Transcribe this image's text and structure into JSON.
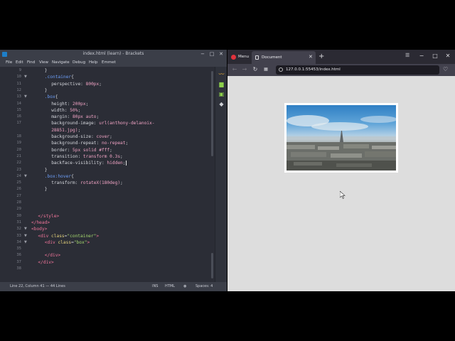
{
  "editor": {
    "title": "index.html (learn) - Brackets",
    "menu": [
      "File",
      "Edit",
      "Find",
      "View",
      "Navigate",
      "Debug",
      "Help",
      "Emmet"
    ],
    "window_controls": [
      "−",
      "□",
      "✕"
    ],
    "lines": [
      {
        "n": "9",
        "fold": "",
        "indent": 2,
        "tokens": [
          {
            "c": "pun",
            "t": "}"
          }
        ]
      },
      {
        "n": "10",
        "fold": "▼",
        "indent": 2,
        "tokens": [
          {
            "c": "sel",
            "t": ".container"
          },
          {
            "c": "pun",
            "t": "{"
          }
        ]
      },
      {
        "n": "11",
        "fold": "",
        "indent": 3,
        "tokens": [
          {
            "c": "prop",
            "t": "perspective: "
          },
          {
            "c": "val",
            "t": "800px"
          },
          {
            "c": "pun",
            "t": ";"
          }
        ]
      },
      {
        "n": "12",
        "fold": "",
        "indent": 2,
        "tokens": [
          {
            "c": "pun",
            "t": "}"
          }
        ]
      },
      {
        "n": "13",
        "fold": "▼",
        "indent": 2,
        "tokens": [
          {
            "c": "sel",
            "t": ".box"
          },
          {
            "c": "pun",
            "t": "{"
          }
        ]
      },
      {
        "n": "14",
        "fold": "",
        "indent": 3,
        "tokens": [
          {
            "c": "prop",
            "t": "height: "
          },
          {
            "c": "val",
            "t": "200px"
          },
          {
            "c": "pun",
            "t": ";"
          }
        ]
      },
      {
        "n": "15",
        "fold": "",
        "indent": 3,
        "tokens": [
          {
            "c": "prop",
            "t": "width: "
          },
          {
            "c": "val",
            "t": "50%"
          },
          {
            "c": "pun",
            "t": ";"
          }
        ]
      },
      {
        "n": "16",
        "fold": "",
        "indent": 3,
        "tokens": [
          {
            "c": "prop",
            "t": "margin: "
          },
          {
            "c": "val",
            "t": "80px auto"
          },
          {
            "c": "pun",
            "t": ";"
          }
        ]
      },
      {
        "n": "17",
        "fold": "",
        "indent": 3,
        "tokens": [
          {
            "c": "prop",
            "t": "background-image: "
          },
          {
            "c": "val",
            "t": "url(anthony-delanoix-"
          }
        ]
      },
      {
        "n": "",
        "fold": "",
        "indent": 3,
        "tokens": [
          {
            "c": "val",
            "t": "28851.jpg)"
          },
          {
            "c": "pun",
            "t": ";"
          }
        ]
      },
      {
        "n": "18",
        "fold": "",
        "indent": 3,
        "tokens": [
          {
            "c": "prop",
            "t": "background-size: "
          },
          {
            "c": "val",
            "t": "cover"
          },
          {
            "c": "pun",
            "t": ";"
          }
        ]
      },
      {
        "n": "19",
        "fold": "",
        "indent": 3,
        "tokens": [
          {
            "c": "prop",
            "t": "background-repeat: "
          },
          {
            "c": "val",
            "t": "no-repeat"
          },
          {
            "c": "pun",
            "t": ";"
          }
        ]
      },
      {
        "n": "20",
        "fold": "",
        "indent": 3,
        "tokens": [
          {
            "c": "prop",
            "t": "border: "
          },
          {
            "c": "val",
            "t": "5px solid #fff"
          },
          {
            "c": "pun",
            "t": ";"
          }
        ]
      },
      {
        "n": "21",
        "fold": "",
        "indent": 3,
        "tokens": [
          {
            "c": "prop",
            "t": "transition: "
          },
          {
            "c": "val",
            "t": "transform 0.3s"
          },
          {
            "c": "pun",
            "t": ";"
          }
        ]
      },
      {
        "n": "22",
        "fold": "",
        "indent": 3,
        "cursor": true,
        "tokens": [
          {
            "c": "prop",
            "t": "backface-visibility: "
          },
          {
            "c": "val",
            "t": "hidden"
          },
          {
            "c": "pun",
            "t": ";"
          }
        ]
      },
      {
        "n": "23",
        "fold": "",
        "indent": 2,
        "tokens": [
          {
            "c": "pun",
            "t": "}"
          }
        ]
      },
      {
        "n": "24",
        "fold": "▼",
        "indent": 2,
        "tokens": [
          {
            "c": "sel",
            "t": ".box:hover"
          },
          {
            "c": "pun",
            "t": "{"
          }
        ]
      },
      {
        "n": "25",
        "fold": "",
        "indent": 3,
        "tokens": [
          {
            "c": "prop",
            "t": "transform: "
          },
          {
            "c": "val",
            "t": "rotateX(180deg)"
          },
          {
            "c": "pun",
            "t": ";"
          }
        ]
      },
      {
        "n": "26",
        "fold": "",
        "indent": 2,
        "tokens": [
          {
            "c": "pun",
            "t": "}"
          }
        ]
      },
      {
        "n": "27",
        "fold": "",
        "indent": 0,
        "tokens": []
      },
      {
        "n": "28",
        "fold": "",
        "indent": 0,
        "tokens": []
      },
      {
        "n": "29",
        "fold": "",
        "indent": 0,
        "tokens": []
      },
      {
        "n": "30",
        "fold": "",
        "indent": 1,
        "tokens": [
          {
            "c": "tag",
            "t": "</style>"
          }
        ]
      },
      {
        "n": "31",
        "fold": "",
        "indent": 0,
        "tokens": [
          {
            "c": "tag",
            "t": "</head>"
          }
        ]
      },
      {
        "n": "32",
        "fold": "▼",
        "indent": 0,
        "tokens": [
          {
            "c": "tag",
            "t": "<body>"
          }
        ]
      },
      {
        "n": "33",
        "fold": "▼",
        "indent": 1,
        "tokens": [
          {
            "c": "tag",
            "t": "<div "
          },
          {
            "c": "attr",
            "t": "class"
          },
          {
            "c": "pun",
            "t": "="
          },
          {
            "c": "str",
            "t": "\"container\""
          },
          {
            "c": "tag",
            "t": ">"
          }
        ]
      },
      {
        "n": "34",
        "fold": "▼",
        "indent": 2,
        "tokens": [
          {
            "c": "tag",
            "t": "<div "
          },
          {
            "c": "attr",
            "t": "class"
          },
          {
            "c": "pun",
            "t": "="
          },
          {
            "c": "str",
            "t": "\"box\""
          },
          {
            "c": "tag",
            "t": ">"
          }
        ]
      },
      {
        "n": "35",
        "fold": "",
        "indent": 0,
        "tokens": []
      },
      {
        "n": "36",
        "fold": "",
        "indent": 2,
        "tokens": [
          {
            "c": "tag",
            "t": "</div>"
          }
        ]
      },
      {
        "n": "37",
        "fold": "",
        "indent": 1,
        "tokens": [
          {
            "c": "tag",
            "t": "</div>"
          }
        ]
      },
      {
        "n": "38",
        "fold": "",
        "indent": 0,
        "tokens": []
      }
    ],
    "status": {
      "position": "Line 22, Column 41 — 44 Lines",
      "mode": "INS",
      "language": "HTML",
      "spaces": "Spaces: 4"
    }
  },
  "browser": {
    "menu_label": "Menu",
    "tab_title": "Document",
    "tab_close": "✕",
    "new_tab": "+",
    "url": "127.0.0.1:55453/index.html",
    "window_controls": [
      "−",
      "□",
      "✕"
    ]
  },
  "colors": {
    "editor_bg": "#2b2d36",
    "selector": "#6c9ef8",
    "value": "#f0a3c4",
    "tag": "#f0759a",
    "page_bg": "#dddddd"
  }
}
